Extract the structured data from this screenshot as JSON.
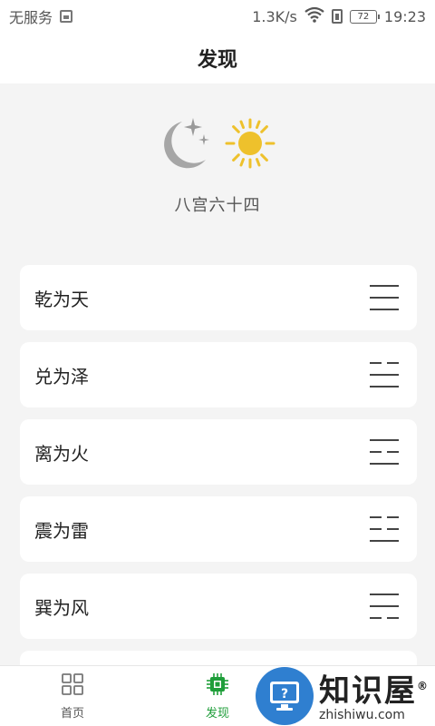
{
  "status_bar": {
    "carrier": "无服务",
    "speed": "1.3K/s",
    "battery": "72",
    "time": "19:23"
  },
  "header": {
    "title": "发现"
  },
  "hero": {
    "caption": "八宫六十四"
  },
  "list": {
    "items": [
      {
        "label": "乾为天",
        "lines": [
          "yang",
          "yang",
          "yang"
        ]
      },
      {
        "label": "兑为泽",
        "lines": [
          "yin",
          "yang",
          "yang"
        ]
      },
      {
        "label": "离为火",
        "lines": [
          "yang",
          "yin",
          "yang"
        ]
      },
      {
        "label": "震为雷",
        "lines": [
          "yin",
          "yin",
          "yang"
        ]
      },
      {
        "label": "巽为风",
        "lines": [
          "yang",
          "yang",
          "yin"
        ]
      }
    ]
  },
  "bottom_nav": {
    "items": [
      {
        "label": "首页",
        "icon": "grid-icon",
        "active": false
      },
      {
        "label": "发现",
        "icon": "chip-icon",
        "active": true
      }
    ],
    "active_color": "#1f9e3a"
  },
  "watermark": {
    "cn": "知识屋",
    "en": "zhishiwu.com",
    "registered": "®"
  }
}
